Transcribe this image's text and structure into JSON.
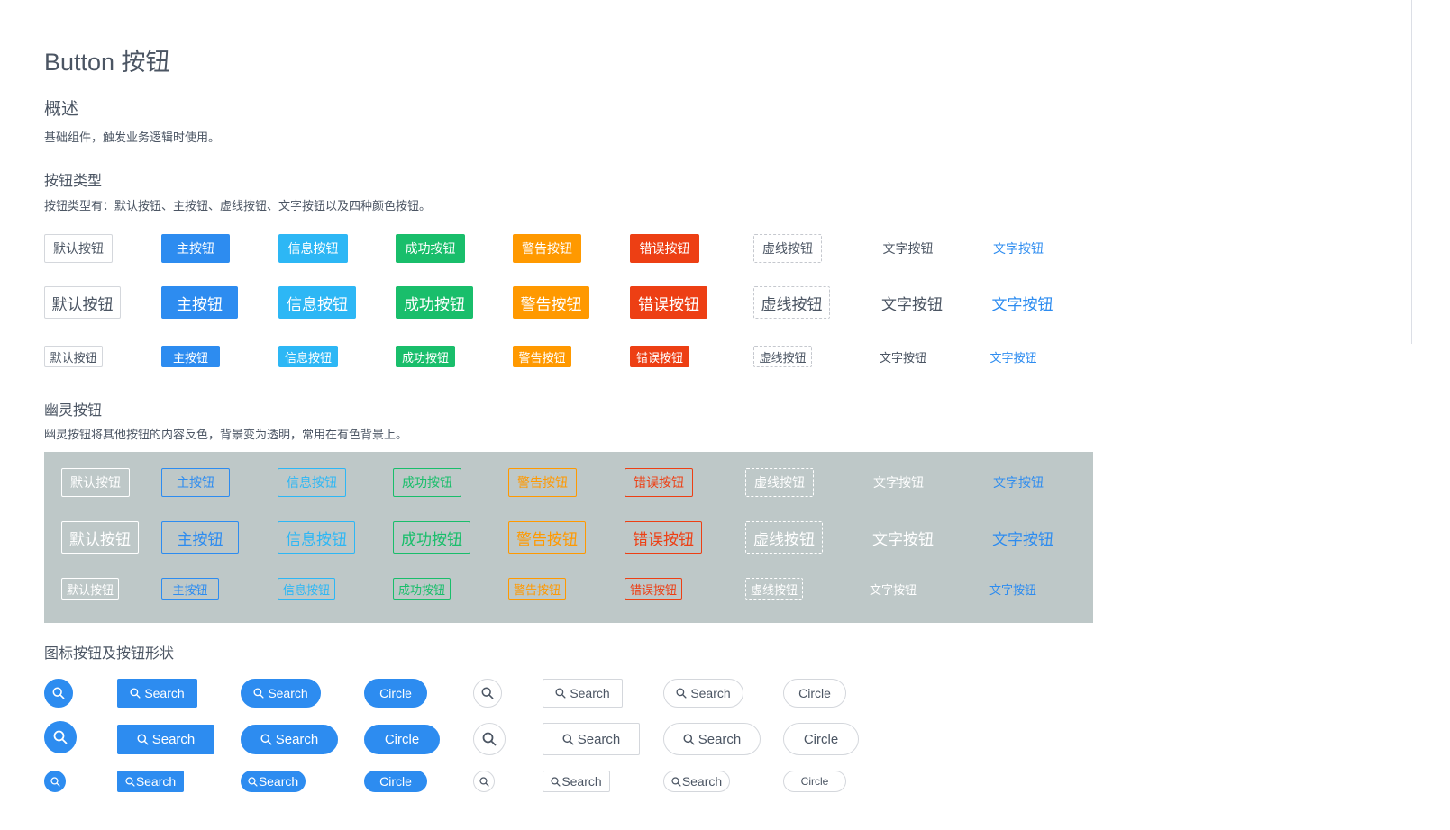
{
  "page": {
    "title": "Button 按钮",
    "overview_heading": "概述",
    "overview_text": "基础组件，触发业务逻辑时使用。"
  },
  "types_section": {
    "heading": "按钮类型",
    "description": "按钮类型有：默认按钮、主按钮、虚线按钮、文字按钮以及四种颜色按钮。",
    "labels": {
      "default": "默认按钮",
      "primary": "主按钮",
      "info": "信息按钮",
      "success": "成功按钮",
      "warning": "警告按钮",
      "error": "错误按钮",
      "dashed": "虚线按钮",
      "text": "文字按钮",
      "link": "文字按钮"
    },
    "sizes": [
      "default",
      "large",
      "small"
    ]
  },
  "ghost_section": {
    "heading": "幽灵按钮",
    "description": "幽灵按钮将其他按钮的内容反色，背景变为透明，常用在有色背景上。",
    "background_color": "#bec8c8",
    "labels": {
      "default": "默认按钮",
      "primary": "主按钮",
      "info": "信息按钮",
      "success": "成功按钮",
      "warning": "警告按钮",
      "error": "错误按钮",
      "dashed": "虚线按钮",
      "text": "文字按钮",
      "link": "文字按钮"
    }
  },
  "icon_section": {
    "heading": "图标按钮及按钮形状",
    "icon": "search-icon",
    "search_label": "Search",
    "circle_label": "Circle",
    "columns": [
      "primary-circle-icon",
      "primary-rect-search",
      "primary-round-search",
      "primary-round-circle",
      "default-circle-icon",
      "default-rect-search",
      "default-round-search",
      "default-round-circle"
    ]
  },
  "colors": {
    "primary": "#2d8cf0",
    "info": "#2db7f5",
    "success": "#19be6b",
    "warning": "#ff9900",
    "error": "#ed3f14",
    "text": "#4b5563"
  }
}
